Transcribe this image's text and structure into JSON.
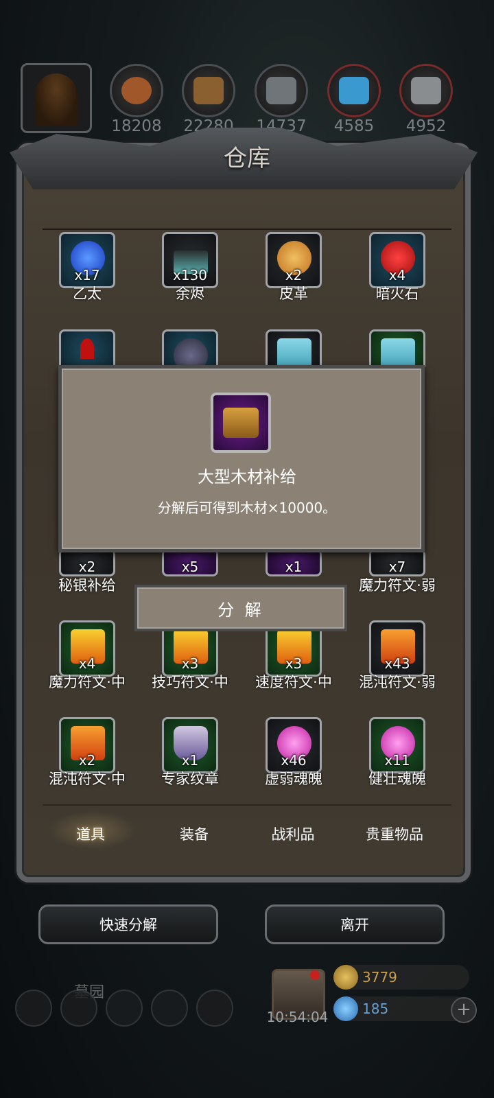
{
  "resources": [
    {
      "value": "18208",
      "icon": "meat-icon",
      "color": "#a0582a"
    },
    {
      "value": "22280",
      "icon": "wood-icon",
      "color": "#8a6030"
    },
    {
      "value": "14737",
      "icon": "iron-icon",
      "color": "#70757a"
    },
    {
      "value": "4585",
      "icon": "crystal-icon",
      "color": "#3a9ad0"
    },
    {
      "value": "4952",
      "icon": "stone-icon",
      "color": "#8a8d90"
    }
  ],
  "warehouse": {
    "title": "仓库"
  },
  "items": [
    {
      "name": "乙太",
      "count": "x17",
      "icon": "ether-icon",
      "color": "#2a6ae0"
    },
    {
      "name": "余烬",
      "count": "x130",
      "icon": "ember-icon",
      "color": "#5ab0b0"
    },
    {
      "name": "皮革",
      "count": "x2",
      "icon": "leather-icon",
      "color": "#e0a040"
    },
    {
      "name": "暗火石",
      "count": "x4",
      "icon": "darkfire-stone-icon",
      "color": "#d02020"
    },
    {
      "name": "秘银补给",
      "count": "x2"
    },
    {
      "name": "",
      "count": "x5"
    },
    {
      "name": "",
      "count": "x1"
    },
    {
      "name": "魔力符文·弱",
      "count": "x7"
    },
    {
      "name": "魔力符文·中",
      "count": "x4",
      "icon": "mana-rune-icon",
      "color": "#f0a020"
    },
    {
      "name": "技巧符文·中",
      "count": "x3",
      "icon": "skill-rune-icon",
      "color": "#f0b020"
    },
    {
      "name": "速度符文·中",
      "count": "x3",
      "icon": "speed-rune-icon",
      "color": "#f0a020"
    },
    {
      "name": "混沌符文·弱",
      "count": "x43",
      "icon": "chaos-rune-icon",
      "color": "#e07020"
    },
    {
      "name": "混沌符文·中",
      "count": "x2",
      "icon": "chaos-rune-icon",
      "color": "#e07020"
    },
    {
      "name": "专家纹章",
      "count": "x1",
      "icon": "expert-crest-icon",
      "color": "#b0a0d0"
    },
    {
      "name": "虚弱魂魄",
      "count": "x46",
      "icon": "weak-soul-icon",
      "color": "#e040c0"
    },
    {
      "name": "健壮魂魄",
      "count": "x11",
      "icon": "strong-soul-icon",
      "color": "#e050b0"
    }
  ],
  "tabs": [
    "道具",
    "装备",
    "战利品",
    "贵重物品"
  ],
  "popup": {
    "title": "大型木材补给",
    "description": "分解后可得到木材×10000。",
    "button": "分 解",
    "icon": "chest-icon"
  },
  "actions": {
    "quick_decompose": "快速分解",
    "leave": "离开"
  },
  "footer": {
    "zone": "墓园",
    "time": "10:54:04",
    "gold": "3779",
    "gems": "185"
  }
}
